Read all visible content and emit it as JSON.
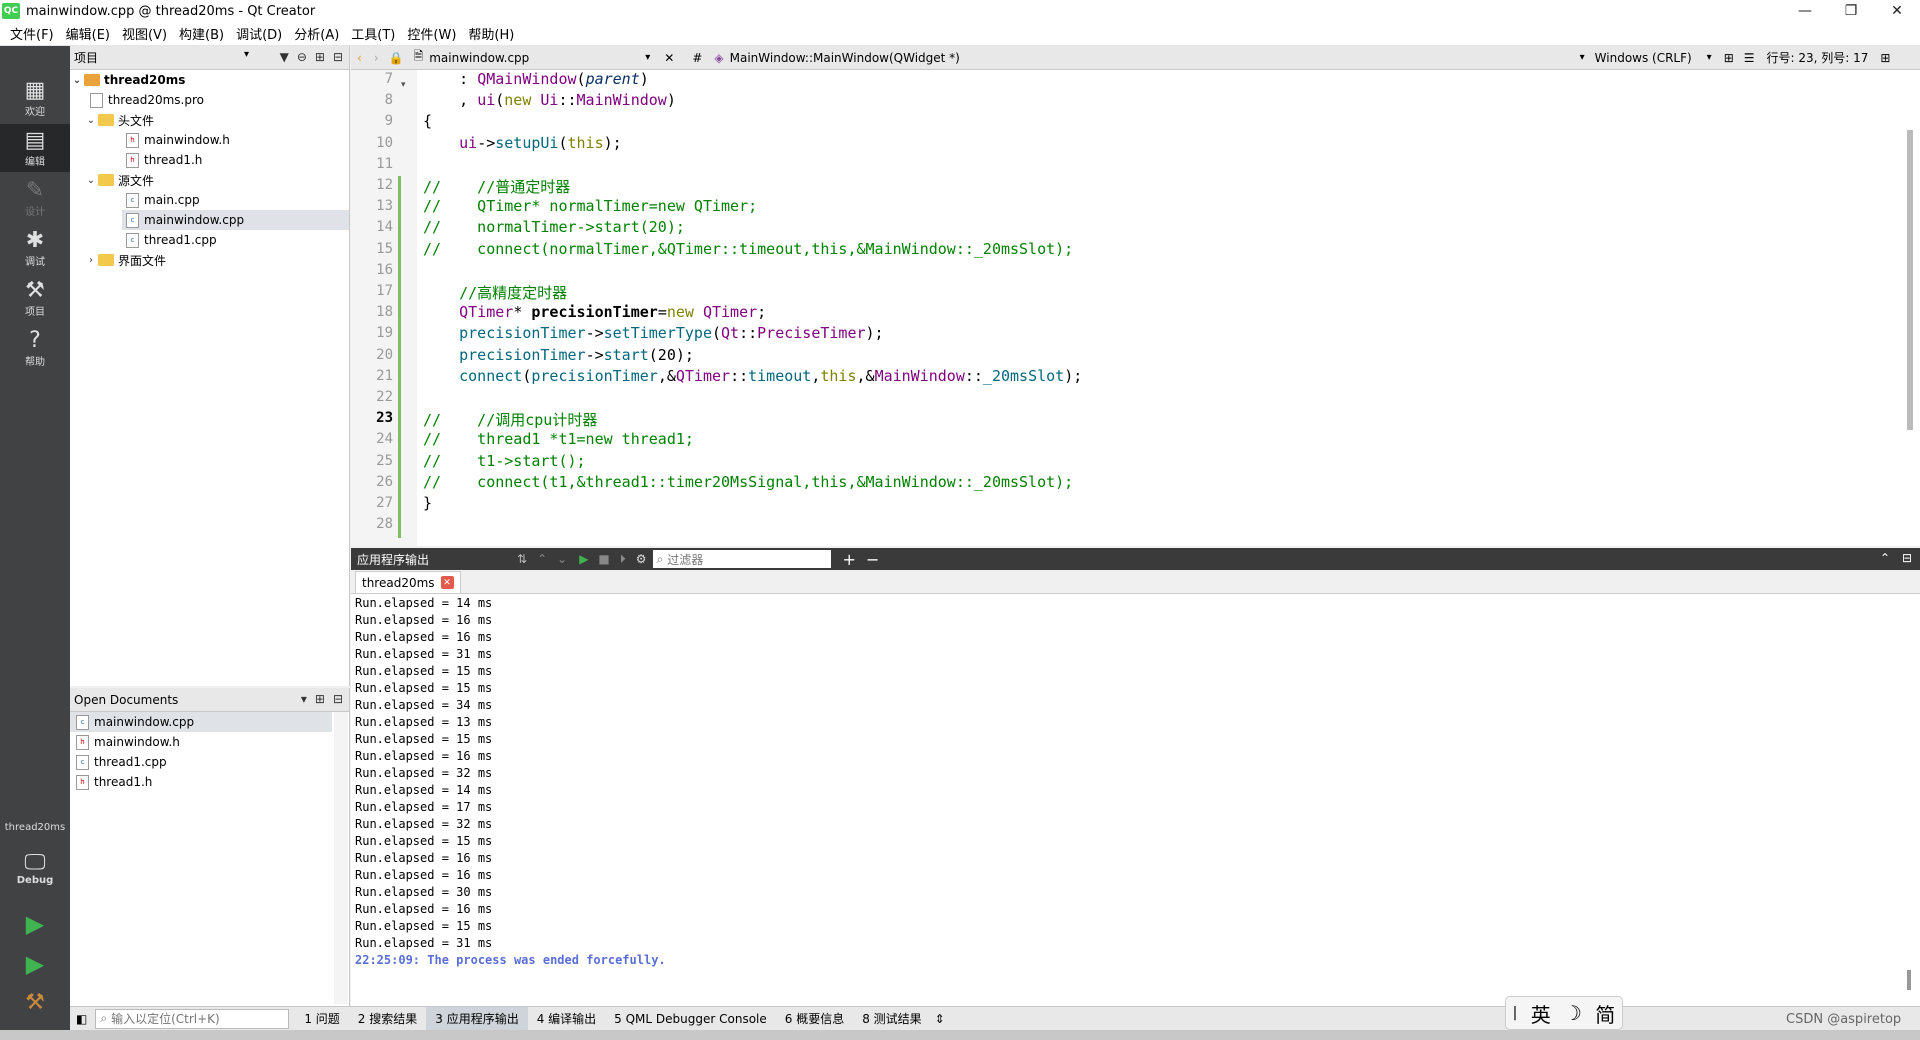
{
  "window": {
    "title": "mainwindow.cpp @ thread20ms - Qt Creator",
    "app_icon": "QC",
    "controls": [
      "—",
      "❐",
      "✕"
    ]
  },
  "menu": [
    "文件(F)",
    "编辑(E)",
    "视图(V)",
    "构建(B)",
    "调试(D)",
    "分析(A)",
    "工具(T)",
    "控件(W)",
    "帮助(H)"
  ],
  "modes": [
    {
      "label": "欢迎",
      "icon": "grid-icon"
    },
    {
      "label": "编辑",
      "icon": "edit-icon"
    },
    {
      "label": "设计",
      "icon": "pencil-icon"
    },
    {
      "label": "调试",
      "icon": "bug-icon"
    },
    {
      "label": "项目",
      "icon": "wrench-icon"
    },
    {
      "label": "帮助",
      "icon": "help-icon"
    }
  ],
  "kit": {
    "project": "thread20ms",
    "config": "Debug"
  },
  "projects_pane": {
    "title": "项目",
    "tree": [
      {
        "label": "thread20ms",
        "level": 0,
        "kind": "project",
        "expanded": true
      },
      {
        "label": "thread20ms.pro",
        "level": 1,
        "kind": "pro"
      },
      {
        "label": "头文件",
        "level": 1,
        "kind": "folder",
        "expanded": true
      },
      {
        "label": "mainwindow.h",
        "level": 2,
        "kind": "h"
      },
      {
        "label": "thread1.h",
        "level": 2,
        "kind": "h"
      },
      {
        "label": "源文件",
        "level": 1,
        "kind": "folder",
        "expanded": true
      },
      {
        "label": "main.cpp",
        "level": 2,
        "kind": "cpp"
      },
      {
        "label": "mainwindow.cpp",
        "level": 2,
        "kind": "cpp",
        "selected": true
      },
      {
        "label": "thread1.cpp",
        "level": 2,
        "kind": "cpp"
      },
      {
        "label": "界面文件",
        "level": 1,
        "kind": "folder",
        "expanded": false
      }
    ]
  },
  "open_documents": {
    "title": "Open Documents",
    "items": [
      "mainwindow.cpp",
      "mainwindow.h",
      "thread1.cpp",
      "thread1.h"
    ]
  },
  "editor_toolbar": {
    "file": "mainwindow.cpp",
    "symbol": "MainWindow::MainWindow(QWidget *)",
    "line_ending": "Windows (CRLF)",
    "position": "行号: 23, 列号: 17",
    "hash": "#"
  },
  "code": {
    "current_line": 23,
    "lines": [
      {
        "n": "7",
        "html": "    : <span class='ty'>QMainWindow</span>(<span class='it'>parent</span>)"
      },
      {
        "n": "8",
        "html": "    , <span class='ty'>ui</span>(<span class='kw'>new</span> <span class='ty'>Ui</span>::<span class='ty'>MainWindow</span>)"
      },
      {
        "n": "9",
        "html": "{"
      },
      {
        "n": "10",
        "html": "    <span class='ty'>ui</span>-><span class='fn'>setupUi</span>(<span class='kw'>this</span>);"
      },
      {
        "n": "11",
        "html": ""
      },
      {
        "n": "12",
        "html": "<span class='cm'>//    //普通定时器</span>"
      },
      {
        "n": "13",
        "html": "<span class='cm'>//    QTimer* normalTimer=new QTimer;</span>"
      },
      {
        "n": "14",
        "html": "<span class='cm'>//    normalTimer->start(20);</span>"
      },
      {
        "n": "15",
        "html": "<span class='cm'>//    connect(normalTimer,&amp;QTimer::timeout,this,&amp;MainWindow::_20msSlot);</span>"
      },
      {
        "n": "16",
        "html": ""
      },
      {
        "n": "17",
        "html": "    <span class='cm'>//高精度定时器</span>"
      },
      {
        "n": "18",
        "html": "    <span class='ty'>QTimer</span>* <span class='bd'>precisionTimer</span>=<span class='kw'>new</span> <span class='ty'>QTimer</span>;"
      },
      {
        "n": "19",
        "html": "    <span class='fn'>precisionTimer</span>-><span class='fn'>setTimerType</span>(<span class='ty'>Qt</span>::<span class='ty'>PreciseTimer</span>);"
      },
      {
        "n": "20",
        "html": "    <span class='fn'>precisionTimer</span>-><span class='fn'>start</span>(20);"
      },
      {
        "n": "21",
        "html": "    <span class='fn'>connect</span>(<span class='fn'>precisionTimer</span>,&amp;<span class='ty'>QTimer</span>::<span class='fn'>timeout</span>,<span class='kw'>this</span>,&amp;<span class='ty'>MainWindow</span>::<span class='fn'>_20msSlot</span>);"
      },
      {
        "n": "22",
        "html": ""
      },
      {
        "n": "23",
        "html": "<span class='cm'>//    //调用cpu计时器</span>"
      },
      {
        "n": "24",
        "html": "<span class='cm'>//    thread1 *t1=new thread1;</span>"
      },
      {
        "n": "25",
        "html": "<span class='cm'>//    t1->start();</span>"
      },
      {
        "n": "26",
        "html": "<span class='cm'>//    connect(t1,&amp;thread1::timer20MsSignal,this,&amp;MainWindow::_20msSlot);</span>"
      },
      {
        "n": "27",
        "html": "}"
      },
      {
        "n": "28",
        "html": ""
      }
    ]
  },
  "output": {
    "title": "应用程序输出",
    "filter_placeholder": "过滤器",
    "tab": "thread20ms",
    "lines": [
      "Run.elapsed = 14 ms",
      "Run.elapsed = 16 ms",
      "Run.elapsed = 16 ms",
      "Run.elapsed = 31 ms",
      "Run.elapsed = 15 ms",
      "Run.elapsed = 15 ms",
      "Run.elapsed = 34 ms",
      "Run.elapsed = 13 ms",
      "Run.elapsed = 15 ms",
      "Run.elapsed = 16 ms",
      "Run.elapsed = 32 ms",
      "Run.elapsed = 14 ms",
      "Run.elapsed = 17 ms",
      "Run.elapsed = 32 ms",
      "Run.elapsed = 15 ms",
      "Run.elapsed = 16 ms",
      "Run.elapsed = 16 ms",
      "Run.elapsed = 30 ms",
      "Run.elapsed = 16 ms",
      "Run.elapsed = 15 ms",
      "Run.elapsed = 31 ms"
    ],
    "final_line": "22:25:09: The process was ended forcefully."
  },
  "status_bar": {
    "locator_placeholder": "输入以定位(Ctrl+K)",
    "panes": [
      "1 问题",
      "2 搜索结果",
      "3 应用程序输出",
      "4 编译输出",
      "5 QML Debugger Console",
      "6 概要信息",
      "8 测试结果"
    ],
    "active_index": 2
  },
  "ime": [
    "英",
    "简"
  ],
  "watermark": "CSDN @aspiretop"
}
